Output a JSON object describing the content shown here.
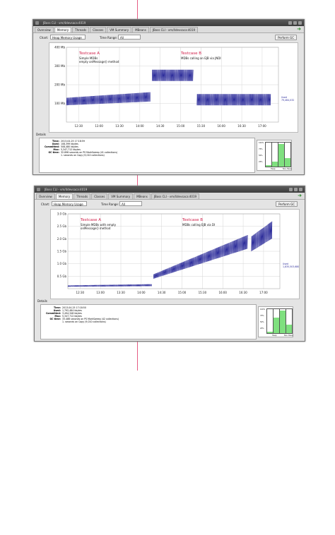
{
  "windows": [
    {
      "title": "JBoss CLI - vm/4devsaca:4019",
      "tabs": [
        "Overview",
        "Memory",
        "Threads",
        "Classes",
        "VM Summary",
        "MBeans",
        "JBoss CLI - vm/4devsaca:4019"
      ],
      "active_tab": 1,
      "chart_label": "Chart:",
      "chart_select": "Heap Memory Usage",
      "time_range_label": "Time Range:",
      "time_range_select": "All",
      "perform_gc": "Perform GC",
      "details_label": "Details",
      "details": [
        {
          "key": "Time:",
          "value": "2013-04-25 17:18:59"
        },
        {
          "key": "Used:",
          "value": "108,399 kbytes"
        },
        {
          "key": "Committed:",
          "value": "508,480 kbytes"
        },
        {
          "key": "Max:",
          "value": "5,347,712 kbytes"
        },
        {
          "key": "GC time:",
          "value": "32.896 seconds on PS MarkSweep (41 collections)"
        },
        {
          "key": "",
          "value": "1. seconds on Copy (9,010 collections)"
        }
      ],
      "pool_ticks": [
        "100%",
        "75%",
        "50%",
        "25%"
      ],
      "pools": [
        {
          "label": "",
          "fill": 0.05
        },
        {
          "label": "Heap",
          "fill": 0.2
        },
        {
          "label": "",
          "fill": 0.95
        },
        {
          "label": "Non-Heap",
          "fill": 0.35
        }
      ],
      "used_label": "Used",
      "used_value": "79,464,032",
      "annotations": [
        {
          "title": "Testcase A",
          "lines": [
            "Simple MDBs",
            "empty onMessage() method"
          ]
        },
        {
          "title": "Testcase B",
          "lines": [
            "MDBs calling an EJB via JNDI"
          ]
        }
      ],
      "chart_data": {
        "type": "line",
        "x_ticks": [
          "12:30",
          "13:00",
          "13:30",
          "14:00",
          "14:30",
          "15:00",
          "15:30",
          "16:00",
          "16:30",
          "17:00"
        ],
        "y_ticks": [
          "100 Mb",
          "200 Mb",
          "300 Mb",
          "400 Mb"
        ],
        "ylim": [
          0,
          400
        ],
        "xlim": [
          12.2,
          17.4
        ],
        "segments": [
          {
            "x0": 12.2,
            "x1": 14.25,
            "base_start": 90,
            "base_end": 110,
            "amp_start": 40,
            "amp_end": 50
          },
          {
            "x0": 14.3,
            "x1": 15.3,
            "base_start": 220,
            "base_end": 220,
            "amp_start": 60,
            "amp_end": 60
          },
          {
            "x0": 15.4,
            "x1": 17.2,
            "base_start": 90,
            "base_end": 90,
            "amp_start": 60,
            "amp_end": 60
          }
        ]
      }
    },
    {
      "title": "JBoss CLI - vm/4devsaca:4019",
      "tabs": [
        "Overview",
        "Memory",
        "Threads",
        "Classes",
        "VM Summary",
        "MBeans",
        "JBoss CLI - vm/4devsaca:4019"
      ],
      "active_tab": 1,
      "chart_label": "Chart:",
      "chart_select": "Heap Memory Usage",
      "time_range_label": "Time Range:",
      "time_range_select": "All",
      "perform_gc": "Perform GC",
      "details_label": "Details",
      "details": [
        {
          "key": "Time:",
          "value": "2013-04-25 17:18:50"
        },
        {
          "key": "Used:",
          "value": "1,792,484 kbytes"
        },
        {
          "key": "Committed:",
          "value": "3,494,348 kbytes"
        },
        {
          "key": "Max:",
          "value": "5,347,712 kbytes"
        },
        {
          "key": "GC time:",
          "value": "33.486 seconds on PS MarkSweep (42 collections)"
        },
        {
          "key": "",
          "value": "1. seconds on Copy (9,010 collections)"
        }
      ],
      "pool_ticks": [
        "100%",
        "75%",
        "50%",
        "25%"
      ],
      "pools": [
        {
          "label": "",
          "fill": 0.05
        },
        {
          "label": "Heap",
          "fill": 0.65
        },
        {
          "label": "",
          "fill": 0.95
        },
        {
          "label": "Non-Heap",
          "fill": 0.35
        }
      ],
      "used_label": "Used",
      "used_value": "1,835,503,680",
      "annotations": [
        {
          "title": "Testcase A",
          "lines": [
            "Simple MDBs with empty",
            "onMessage() method"
          ]
        },
        {
          "title": "Testcase B",
          "lines": [
            "MDBs calling EJB via DI"
          ]
        }
      ],
      "chart_data": {
        "type": "line",
        "x_ticks": [
          "12:30",
          "13:00",
          "13:30",
          "14:00",
          "14:30",
          "15:00",
          "15:30",
          "16:00",
          "16:30",
          "17:00"
        ],
        "y_ticks": [
          "0.5 Gb",
          "1.0 Gb",
          "1.5 Gb",
          "2.0 Gb",
          "2.5 Gb",
          "3.0 Gb"
        ],
        "ylim": [
          0,
          3.0
        ],
        "xlim": [
          12.2,
          17.4
        ],
        "segments": [
          {
            "x0": 12.2,
            "x1": 14.25,
            "base_start": 0.08,
            "base_end": 0.1,
            "amp_start": 0.05,
            "amp_end": 0.08
          },
          {
            "x0": 14.3,
            "x1": 16.6,
            "base_start": 0.4,
            "base_end": 1.6,
            "amp_start": 0.18,
            "amp_end": 0.55
          },
          {
            "x0": 16.7,
            "x1": 17.2,
            "base_start": 1.5,
            "base_end": 2.0,
            "amp_start": 0.6,
            "amp_end": 0.7
          }
        ]
      }
    }
  ],
  "colors": {
    "series": "#2b2b9a",
    "annotation_title": "#d0204a",
    "grid": "#d6d6d6",
    "divider": "#e04070",
    "pool_fill": "#7fe07f"
  }
}
